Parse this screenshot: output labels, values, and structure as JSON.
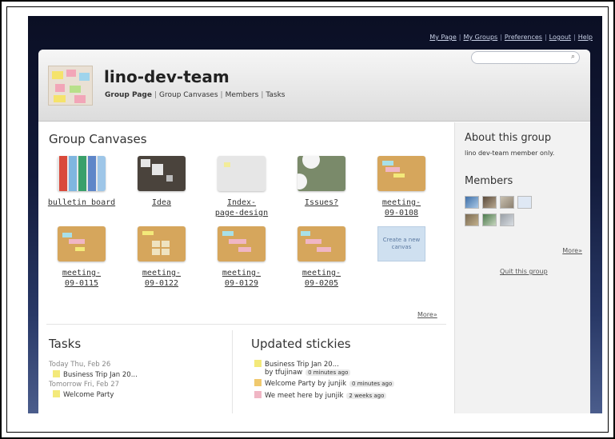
{
  "top_links": [
    "My Page",
    "My Groups",
    "Preferences",
    "Logout",
    "Help"
  ],
  "header": {
    "title": "lino-dev-team",
    "nav": [
      "Group Page",
      "Group Canvases",
      "Members",
      "Tasks"
    ]
  },
  "group_canvases": {
    "heading": "Group Canvases",
    "tiles": [
      {
        "label": "bulletin board"
      },
      {
        "label": "Idea"
      },
      {
        "label_line1": "Index-",
        "label_line2": "page-design"
      },
      {
        "label": "Issues?"
      },
      {
        "label_line1": "meeting-",
        "label_line2": "09-0108"
      },
      {
        "label_line1": "meeting-",
        "label_line2": "09-0115"
      },
      {
        "label_line1": "meeting-",
        "label_line2": "09-0122"
      },
      {
        "label_line1": "meeting-",
        "label_line2": "09-0129"
      },
      {
        "label_line1": "meeting-",
        "label_line2": "09-0205"
      }
    ],
    "create_new": "Create a new canvas",
    "more": "More»"
  },
  "tasks": {
    "heading": "Tasks",
    "today": "Today Thu, Feb 26",
    "today_item": "Business Trip Jan 20...",
    "tomorrow": "Tomorrow Fri, Feb 27",
    "tomorrow_item": "Welcome Party"
  },
  "updated_stickies": {
    "heading": "Updated stickies",
    "items": [
      {
        "title": "Business Trip Jan 20...",
        "by": "by tfujinaw",
        "time": "0 minutes ago",
        "color": "#f3e97a"
      },
      {
        "title": "Welcome Party",
        "by": "by junjik",
        "time": "0 minutes ago",
        "color": "#f0c96e"
      },
      {
        "title": "We meet here",
        "by": "by junjik",
        "time": "2 weeks ago",
        "color": "#f0b6c4"
      }
    ]
  },
  "about": {
    "heading": "About this group",
    "description": "lino dev-team member only.",
    "members_heading": "Members",
    "more": "More»",
    "quit": "Quit this group"
  },
  "colors": {
    "page_bg_top": "#0b0f24",
    "page_bg_bottom": "#4b5d8c",
    "sidebar_bg": "#f2f2f2",
    "sticky_yellow": "#f3e97a"
  }
}
